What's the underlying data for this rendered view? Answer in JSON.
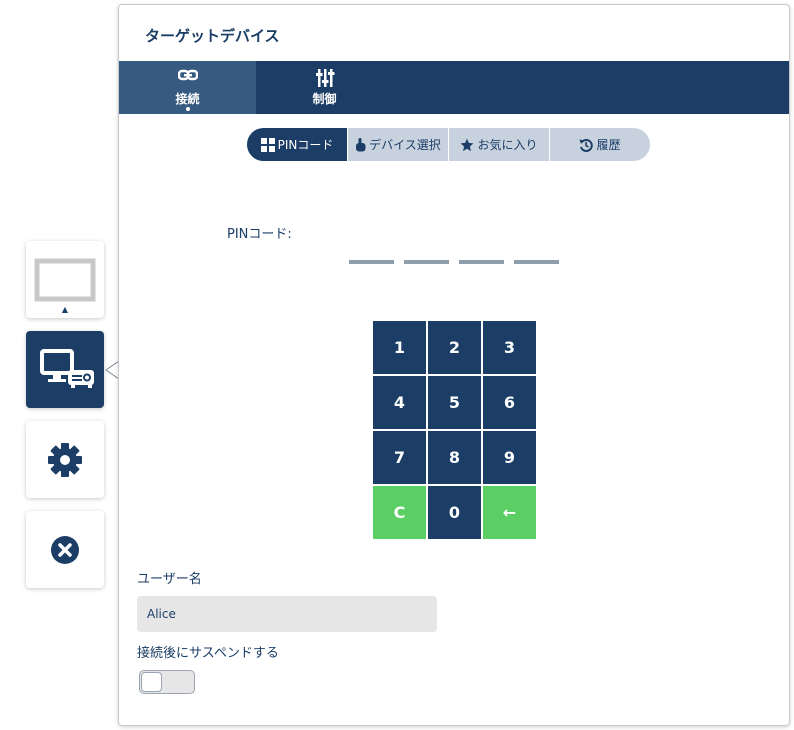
{
  "panel": {
    "title": "ターゲットデバイス"
  },
  "top_tabs": [
    {
      "label": "接続",
      "icon": "link-icon",
      "active": true
    },
    {
      "label": "制御",
      "icon": "sliders-icon",
      "active": false
    }
  ],
  "sub_tabs": [
    {
      "label": "PINコード",
      "icon": "grid-icon",
      "active": true
    },
    {
      "label": "デバイス選択",
      "icon": "hand-pointer-icon",
      "active": false
    },
    {
      "label": "お気に入り",
      "icon": "star-icon",
      "active": false
    },
    {
      "label": "履歴",
      "icon": "history-icon",
      "active": false
    }
  ],
  "pin": {
    "label": "PINコード:",
    "slots": 4
  },
  "keypad": {
    "keys": [
      "1",
      "2",
      "3",
      "4",
      "5",
      "6",
      "7",
      "8",
      "9",
      "C",
      "0",
      "←"
    ]
  },
  "user": {
    "label": "ユーザー名",
    "value": "Alice"
  },
  "suspend": {
    "label": "接続後にサスペンドする",
    "enabled": false
  },
  "rail": [
    {
      "name": "screen-icon",
      "active": false
    },
    {
      "name": "monitor-projector-icon",
      "active": true
    },
    {
      "name": "gear-icon",
      "active": false
    },
    {
      "name": "close-icon",
      "active": false
    }
  ],
  "colors": {
    "navy": "#1b3d66",
    "tab_active": "#365a80",
    "segment_bg": "#c7d2de",
    "green": "#5ccf64",
    "input_bg": "#e6e6e6"
  }
}
